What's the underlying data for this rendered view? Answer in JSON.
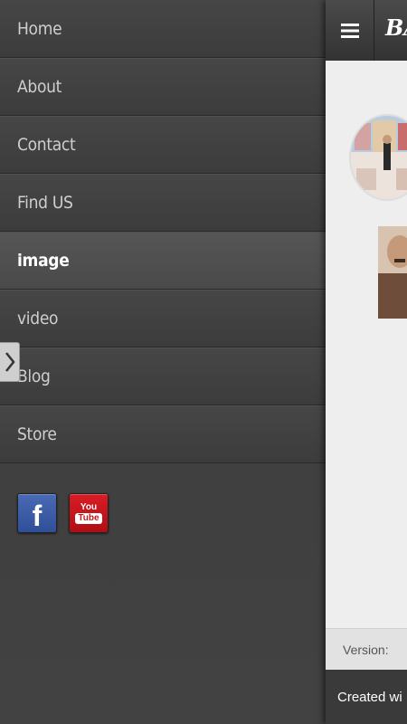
{
  "drawer": {
    "items": [
      {
        "label": "Home"
      },
      {
        "label": "About"
      },
      {
        "label": "Contact"
      },
      {
        "label": "Find US"
      },
      {
        "label": "image",
        "active": true
      },
      {
        "label": "video"
      },
      {
        "label": "Blog"
      },
      {
        "label": "Store"
      }
    ],
    "social": [
      {
        "icon": "facebook-icon",
        "text": "f"
      },
      {
        "icon": "youtube-icon",
        "text_top": "You",
        "text_bottom": "Tube"
      }
    ]
  },
  "page": {
    "brand": "BA",
    "version_label": "Version:",
    "created_text": "Created wi"
  },
  "colors": {
    "facebook": "#3b5998",
    "youtube": "#cc181e"
  }
}
